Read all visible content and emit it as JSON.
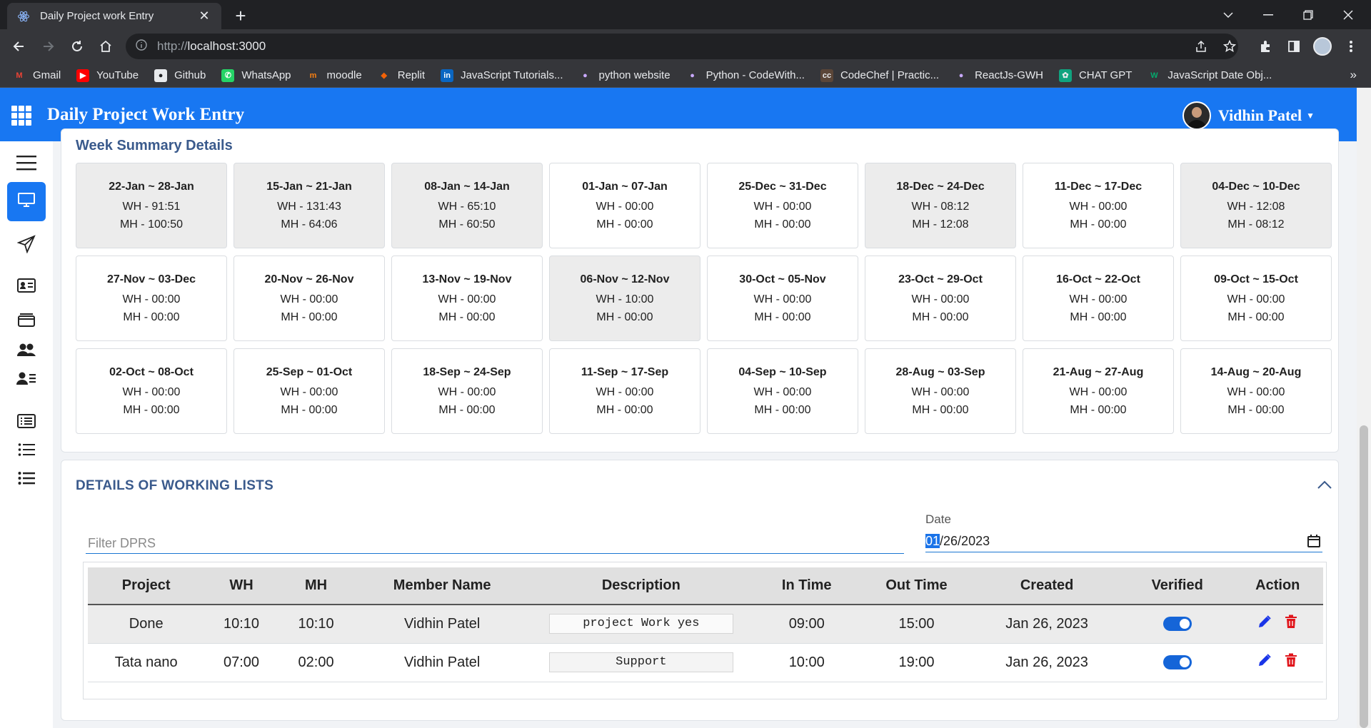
{
  "browser": {
    "tab_title": "Daily Project work Entry",
    "url_prefix": "http://",
    "url_host": "localhost:3000",
    "bookmarks": [
      {
        "label": "Gmail",
        "icon": "gmail-icon"
      },
      {
        "label": "YouTube",
        "icon": "youtube-icon"
      },
      {
        "label": "Github",
        "icon": "github-icon"
      },
      {
        "label": "WhatsApp",
        "icon": "whatsapp-icon"
      },
      {
        "label": "moodle",
        "icon": "moodle-icon"
      },
      {
        "label": "Replit",
        "icon": "replit-icon"
      },
      {
        "label": "JavaScript Tutorials...",
        "icon": "linkedin-icon"
      },
      {
        "label": "python website",
        "icon": "globe-icon"
      },
      {
        "label": "Python - CodeWith...",
        "icon": "globe-icon"
      },
      {
        "label": "CodeChef | Practic...",
        "icon": "codechef-icon"
      },
      {
        "label": "ReactJs-GWH",
        "icon": "globe-icon"
      },
      {
        "label": "CHAT GPT",
        "icon": "chatgpt-icon"
      },
      {
        "label": "JavaScript Date Obj...",
        "icon": "w3schools-icon"
      }
    ],
    "bookmarks_more": "»"
  },
  "app": {
    "title": "Daily Project Work Entry",
    "user_name": "Vidhin Patel",
    "accent": "#1877f2"
  },
  "week_summary": {
    "title": "Week Summary Details",
    "weeks": [
      {
        "range": "22-Jan ~ 28-Jan",
        "wh": "WH - 91:51",
        "mh": "MH - 100:50",
        "shaded": true
      },
      {
        "range": "15-Jan ~ 21-Jan",
        "wh": "WH - 131:43",
        "mh": "MH - 64:06",
        "shaded": true
      },
      {
        "range": "08-Jan ~ 14-Jan",
        "wh": "WH - 65:10",
        "mh": "MH - 60:50",
        "shaded": true
      },
      {
        "range": "01-Jan ~ 07-Jan",
        "wh": "WH - 00:00",
        "mh": "MH - 00:00",
        "shaded": false
      },
      {
        "range": "25-Dec ~ 31-Dec",
        "wh": "WH - 00:00",
        "mh": "MH - 00:00",
        "shaded": false
      },
      {
        "range": "18-Dec ~ 24-Dec",
        "wh": "WH - 08:12",
        "mh": "MH - 12:08",
        "shaded": true
      },
      {
        "range": "11-Dec ~ 17-Dec",
        "wh": "WH - 00:00",
        "mh": "MH - 00:00",
        "shaded": false
      },
      {
        "range": "04-Dec ~ 10-Dec",
        "wh": "WH - 12:08",
        "mh": "MH - 08:12",
        "shaded": true
      },
      {
        "range": "27-Nov ~ 03-Dec",
        "wh": "WH - 00:00",
        "mh": "MH - 00:00",
        "shaded": false
      },
      {
        "range": "20-Nov ~ 26-Nov",
        "wh": "WH - 00:00",
        "mh": "MH - 00:00",
        "shaded": false
      },
      {
        "range": "13-Nov ~ 19-Nov",
        "wh": "WH - 00:00",
        "mh": "MH - 00:00",
        "shaded": false
      },
      {
        "range": "06-Nov ~ 12-Nov",
        "wh": "WH - 10:00",
        "mh": "MH - 00:00",
        "shaded": true
      },
      {
        "range": "30-Oct ~ 05-Nov",
        "wh": "WH - 00:00",
        "mh": "MH - 00:00",
        "shaded": false
      },
      {
        "range": "23-Oct ~ 29-Oct",
        "wh": "WH - 00:00",
        "mh": "MH - 00:00",
        "shaded": false
      },
      {
        "range": "16-Oct ~ 22-Oct",
        "wh": "WH - 00:00",
        "mh": "MH - 00:00",
        "shaded": false
      },
      {
        "range": "09-Oct ~ 15-Oct",
        "wh": "WH - 00:00",
        "mh": "MH - 00:00",
        "shaded": false
      },
      {
        "range": "02-Oct ~ 08-Oct",
        "wh": "WH - 00:00",
        "mh": "MH - 00:00",
        "shaded": false
      },
      {
        "range": "25-Sep ~ 01-Oct",
        "wh": "WH - 00:00",
        "mh": "MH - 00:00",
        "shaded": false
      },
      {
        "range": "18-Sep ~ 24-Sep",
        "wh": "WH - 00:00",
        "mh": "MH - 00:00",
        "shaded": false
      },
      {
        "range": "11-Sep ~ 17-Sep",
        "wh": "WH - 00:00",
        "mh": "MH - 00:00",
        "shaded": false
      },
      {
        "range": "04-Sep ~ 10-Sep",
        "wh": "WH - 00:00",
        "mh": "MH - 00:00",
        "shaded": false
      },
      {
        "range": "28-Aug ~ 03-Sep",
        "wh": "WH - 00:00",
        "mh": "MH - 00:00",
        "shaded": false
      },
      {
        "range": "21-Aug ~ 27-Aug",
        "wh": "WH - 00:00",
        "mh": "MH - 00:00",
        "shaded": false
      },
      {
        "range": "14-Aug ~ 20-Aug",
        "wh": "WH - 00:00",
        "mh": "MH - 00:00",
        "shaded": false
      }
    ]
  },
  "working_list": {
    "title": "DETAILS OF WORKING LISTS",
    "filter_placeholder": "Filter DPRS",
    "filter_value": "",
    "date_label": "Date",
    "date_selected_part": "01",
    "date_rest": "/26/2023",
    "columns": [
      "Project",
      "WH",
      "MH",
      "Member Name",
      "Description",
      "In Time",
      "Out Time",
      "Created",
      "Verified",
      "Action"
    ],
    "rows": [
      {
        "project": "Done",
        "wh": "10:10",
        "mh": "10:10",
        "member": "Vidhin Patel",
        "description": "project Work yes",
        "in_time": "09:00",
        "out_time": "15:00",
        "created": "Jan 26, 2023",
        "verified": true
      },
      {
        "project": "Tata nano",
        "wh": "07:00",
        "mh": "02:00",
        "member": "Vidhin Patel",
        "description": "Support",
        "in_time": "10:00",
        "out_time": "19:00",
        "created": "Jan 26, 2023",
        "verified": true
      }
    ],
    "edit_color": "#1a35e8",
    "delete_color": "#e0151b"
  }
}
